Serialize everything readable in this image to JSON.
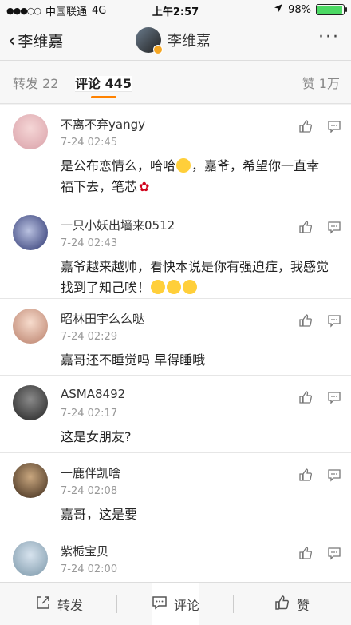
{
  "status_bar": {
    "signal_dots": "●●●○○",
    "carrier": "中国联通",
    "network": "4G",
    "time": "上午2:57",
    "battery_percent": "98%",
    "battery_level": 0.98
  },
  "nav": {
    "back_label": "李维嘉",
    "title": "李维嘉",
    "more": "···"
  },
  "tabs": {
    "repost": "转发 22",
    "comment": "评论 445",
    "like": "赞 1万"
  },
  "comments": [
    {
      "username": "不离不弃yangy",
      "time": "7-24 02:45",
      "text_a": "是公布恋情么，哈哈",
      "text_b": "，嘉爷，希望你一直幸福下去，笔芯",
      "emoji": "grinning-face",
      "flower": "rose"
    },
    {
      "username": "一只小妖出墙来0512",
      "time": "7-24 02:43",
      "text": "嘉爷越来越帅，看快本说是你有强迫症，我感觉找到了知己唉！",
      "emoji_count": 3
    },
    {
      "username": "昭林田宇么么哒",
      "time": "7-24 02:29",
      "text": "嘉哥还不睡觉吗 早得睡哦"
    },
    {
      "username": "ASMA8492",
      "time": "7-24 02:17",
      "text": "这是女朋友?"
    },
    {
      "username": "一鹿伴凯啥",
      "time": "7-24 02:08",
      "text": "嘉哥，这是要"
    },
    {
      "username": "紫栀宝贝",
      "time": "7-24 02:00",
      "text": ""
    }
  ],
  "bottom_bar": {
    "repost": "转发",
    "comment": "评论",
    "like": "赞"
  },
  "colors": {
    "accent": "#ff8200",
    "battery": "#4cd964"
  }
}
